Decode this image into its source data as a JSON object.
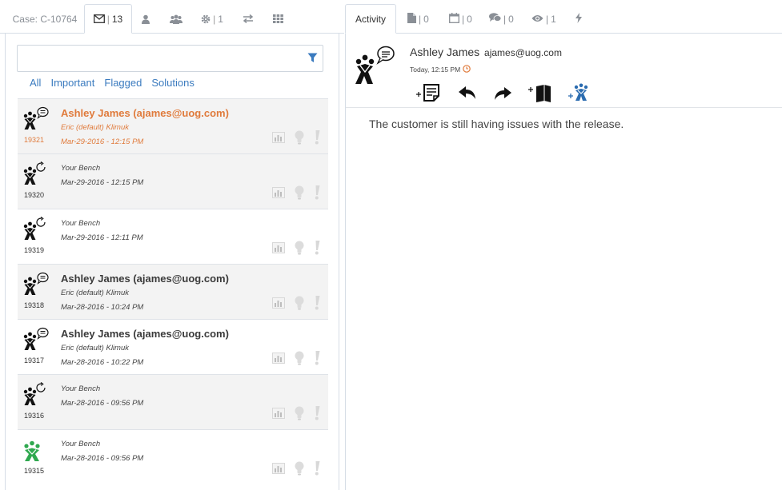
{
  "left_tabs": {
    "case_label": "Case: C-10764",
    "email_count": "13",
    "settings_count": "1"
  },
  "search": {
    "placeholder": "",
    "value": ""
  },
  "filters": [
    "All",
    "Important",
    "Flagged",
    "Solutions"
  ],
  "items": [
    {
      "id": "19321",
      "sender": "Ashley James (ajames@uog.com)",
      "line1": "Eric (default) Klimuk",
      "line2": "Mar-29-2016 - 12:15 PM",
      "type": "email",
      "selected": true
    },
    {
      "id": "19320",
      "sender": "",
      "line1": "Your Bench",
      "line2": "Mar-29-2016 - 12:15 PM",
      "type": "refresh",
      "selected": false
    },
    {
      "id": "19319",
      "sender": "",
      "line1": "Your Bench",
      "line2": "Mar-29-2016 - 12:11 PM",
      "type": "refresh",
      "selected": false
    },
    {
      "id": "19318",
      "sender": "Ashley James (ajames@uog.com)",
      "line1": "Eric (default) Klimuk",
      "line2": "Mar-28-2016 - 10:24 PM",
      "type": "email",
      "selected": false
    },
    {
      "id": "19317",
      "sender": "Ashley James (ajames@uog.com)",
      "line1": "Eric (default) Klimuk",
      "line2": "Mar-28-2016 - 10:22 PM",
      "type": "email",
      "selected": false
    },
    {
      "id": "19316",
      "sender": "",
      "line1": "Your Bench",
      "line2": "Mar-28-2016 - 09:56 PM",
      "type": "refresh",
      "selected": false
    },
    {
      "id": "19315",
      "sender": "",
      "line1": "Your Bench",
      "line2": "Mar-28-2016 - 09:56 PM",
      "type": "green",
      "selected": false
    }
  ],
  "right_tabs": {
    "activity_label": "Activity",
    "docs_count": "0",
    "calendar_count": "0",
    "comments_count": "0",
    "views_count": "1"
  },
  "detail": {
    "name": "Ashley James",
    "email": "ajames@uog.com",
    "time": "Today, 12:15 PM",
    "message": "The customer is still having issues with the release."
  },
  "colors": {
    "accent_orange": "#e07b3c",
    "link_blue": "#3b7bbf",
    "green_icon": "#2fa84f"
  }
}
